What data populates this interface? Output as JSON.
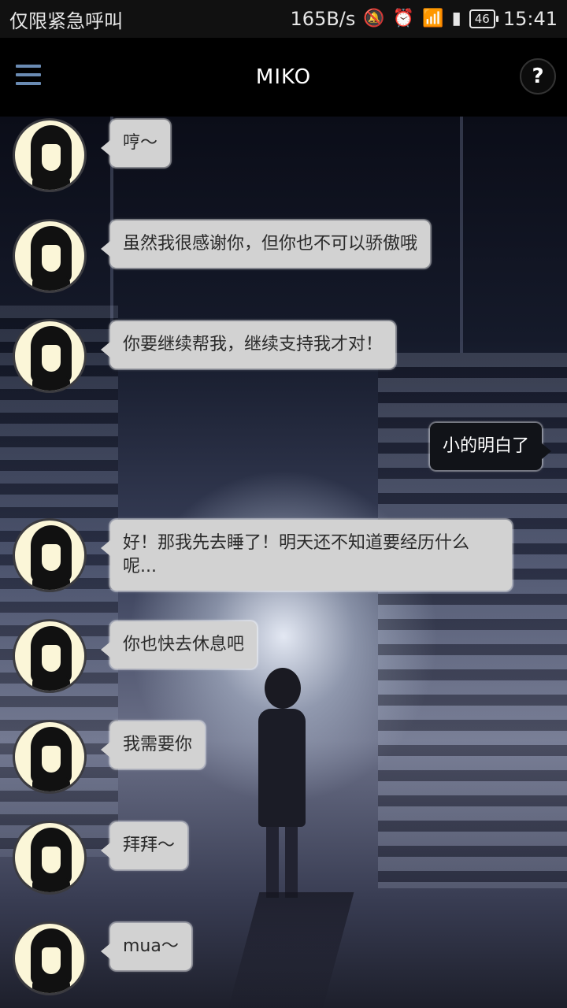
{
  "status_bar": {
    "carrier": "仅限紧急呼叫",
    "net_speed": "165B/s",
    "battery": "46",
    "time": "15:41"
  },
  "app_bar": {
    "title": "MIKO",
    "help_label": "?"
  },
  "messages": [
    {
      "from": "miko",
      "text": "哼～"
    },
    {
      "from": "miko",
      "text": "虽然我很感谢你，但你也不可以骄傲哦"
    },
    {
      "from": "miko",
      "text": "你要继续帮我，继续支持我才对！"
    },
    {
      "from": "me",
      "text": "小的明白了"
    },
    {
      "from": "miko",
      "text": "好！那我先去睡了！明天还不知道要经历什么呢..."
    },
    {
      "from": "miko",
      "text": "你也快去休息吧"
    },
    {
      "from": "miko",
      "text": "我需要你"
    },
    {
      "from": "miko",
      "text": "拜拜～"
    },
    {
      "from": "miko",
      "text": "mua～"
    }
  ]
}
